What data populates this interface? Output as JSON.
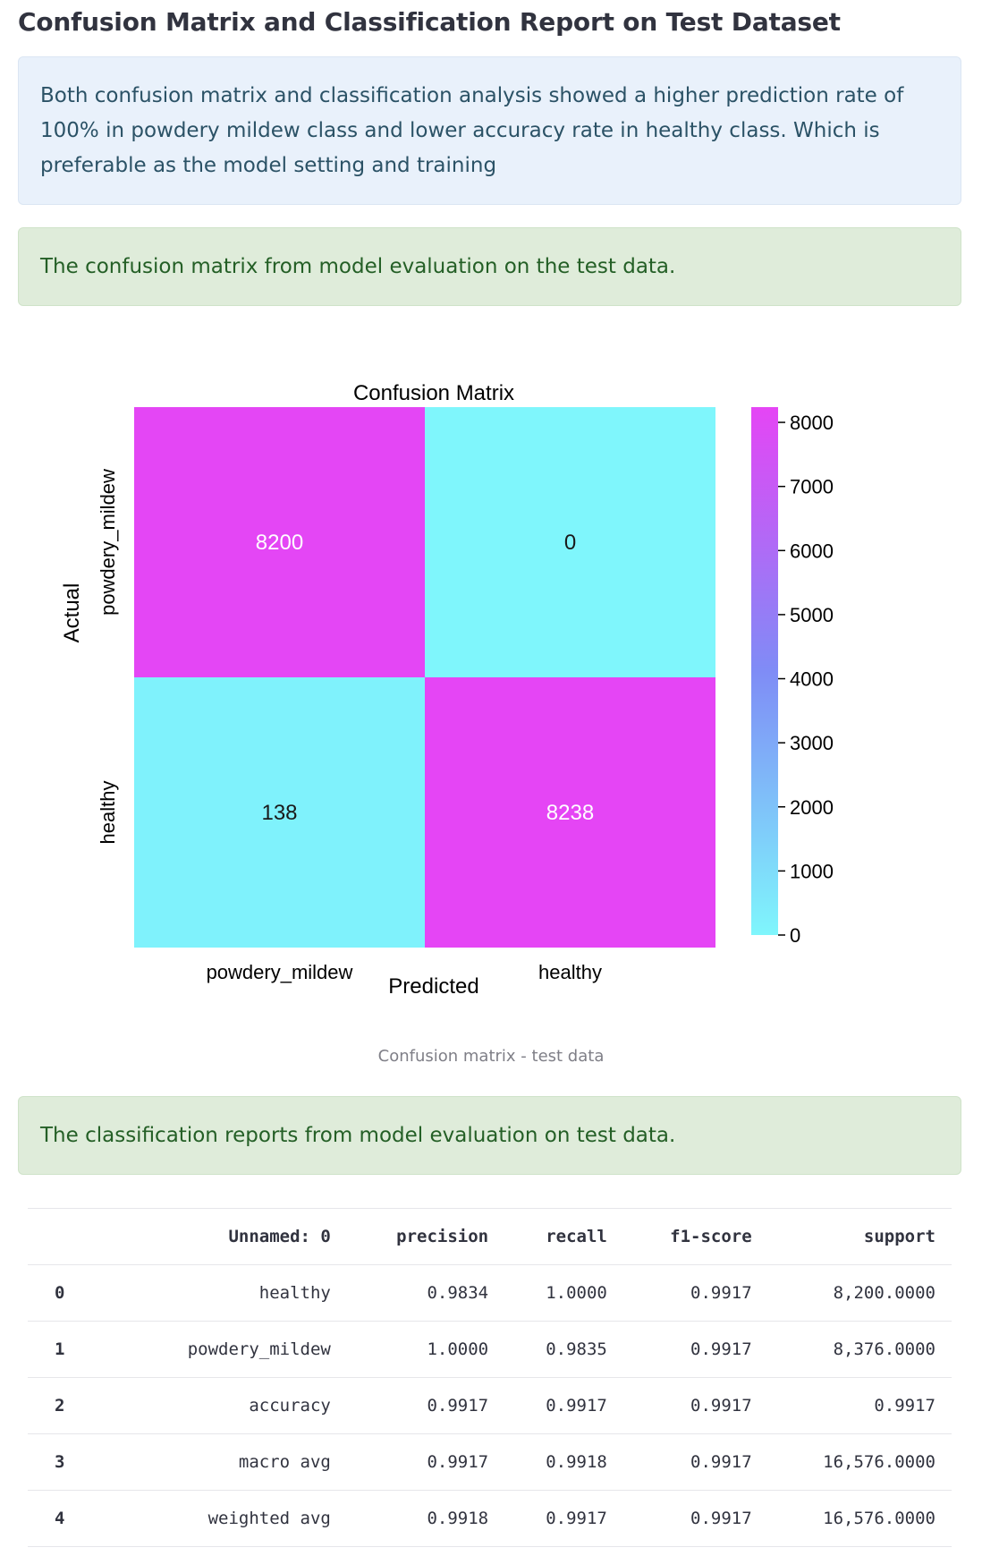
{
  "page_title": "Confusion Matrix and Classification Report on Test Dataset",
  "info_text": "Both confusion matrix and classification analysis showed a higher prediction rate of 100% in powdery mildew class and lower accuracy rate in healthy class. Which is preferable as the model setting and training",
  "success_text_1": "The confusion matrix from model evaluation on the test data.",
  "image_caption": "Confusion matrix - test data",
  "success_text_2": "The classification reports from model evaluation on test data.",
  "colors": {
    "heat_low": "#7ff6fc",
    "heat_mid": "#7f8cf6",
    "heat_high": "#e545f5",
    "info_bg": "#e9f1fb",
    "success_bg": "#dfecda"
  },
  "chart_data": {
    "type": "heatmap",
    "title": "Confusion Matrix",
    "xlabel": "Predicted",
    "ylabel": "Actual",
    "x_categories": [
      "powdery_mildew",
      "healthy"
    ],
    "y_categories": [
      "powdery_mildew",
      "healthy"
    ],
    "values": [
      [
        8200,
        0
      ],
      [
        138,
        8238
      ]
    ],
    "colorbar": {
      "min": 0,
      "max": 8238,
      "ticks": [
        0,
        1000,
        2000,
        3000,
        4000,
        5000,
        6000,
        7000,
        8000
      ]
    }
  },
  "report": {
    "columns": [
      "",
      "Unnamed: 0",
      "precision",
      "recall",
      "f1-score",
      "support"
    ],
    "rows": [
      [
        "0",
        "healthy",
        "0.9834",
        "1.0000",
        "0.9917",
        "8,200.0000"
      ],
      [
        "1",
        "powdery_mildew",
        "1.0000",
        "0.9835",
        "0.9917",
        "8,376.0000"
      ],
      [
        "2",
        "accuracy",
        "0.9917",
        "0.9917",
        "0.9917",
        "0.9917"
      ],
      [
        "3",
        "macro avg",
        "0.9917",
        "0.9918",
        "0.9917",
        "16,576.0000"
      ],
      [
        "4",
        "weighted avg",
        "0.9918",
        "0.9917",
        "0.9917",
        "16,576.0000"
      ]
    ]
  }
}
